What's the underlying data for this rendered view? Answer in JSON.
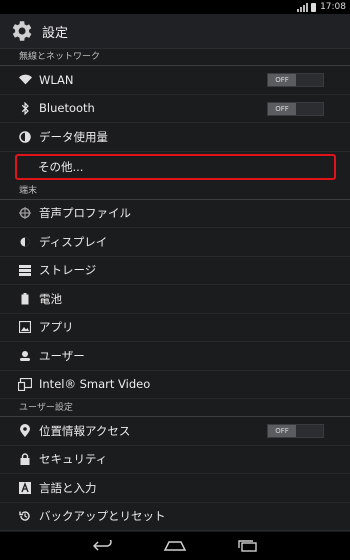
{
  "status": {
    "time": "17:08"
  },
  "app": {
    "title": "設定"
  },
  "sections": {
    "wireless": "無線とネットワーク",
    "device": "端末",
    "user": "ユーザー設定"
  },
  "items": {
    "wlan": {
      "label": "WLAN",
      "toggle": "OFF",
      "icon": "wifi-icon"
    },
    "bluetooth": {
      "label": "Bluetooth",
      "toggle": "OFF",
      "icon": "bluetooth-icon"
    },
    "data_usage": {
      "label": "データ使用量",
      "icon": "data-usage-icon"
    },
    "more": {
      "label": "その他..."
    },
    "sound": {
      "label": "音声プロファイル",
      "icon": "sound-profile-icon"
    },
    "display": {
      "label": "ディスプレイ",
      "icon": "display-icon"
    },
    "storage": {
      "label": "ストレージ",
      "icon": "storage-icon"
    },
    "battery": {
      "label": "電池",
      "icon": "battery-icon"
    },
    "apps": {
      "label": "アプリ",
      "icon": "apps-icon"
    },
    "users": {
      "label": "ユーザー",
      "icon": "user-icon"
    },
    "intel_smart_video": {
      "label": "Intel® Smart Video",
      "icon": "intel-smart-video-icon"
    },
    "location": {
      "label": "位置情報アクセス",
      "toggle": "OFF",
      "icon": "location-icon"
    },
    "security": {
      "label": "セキュリティ",
      "icon": "lock-icon"
    },
    "language": {
      "label": "言語と入力",
      "icon": "language-icon"
    },
    "backup": {
      "label": "バックアップとリセット",
      "icon": "backup-icon"
    }
  },
  "colors": {
    "highlight": "#e01418",
    "background": "#1b1c1e"
  }
}
